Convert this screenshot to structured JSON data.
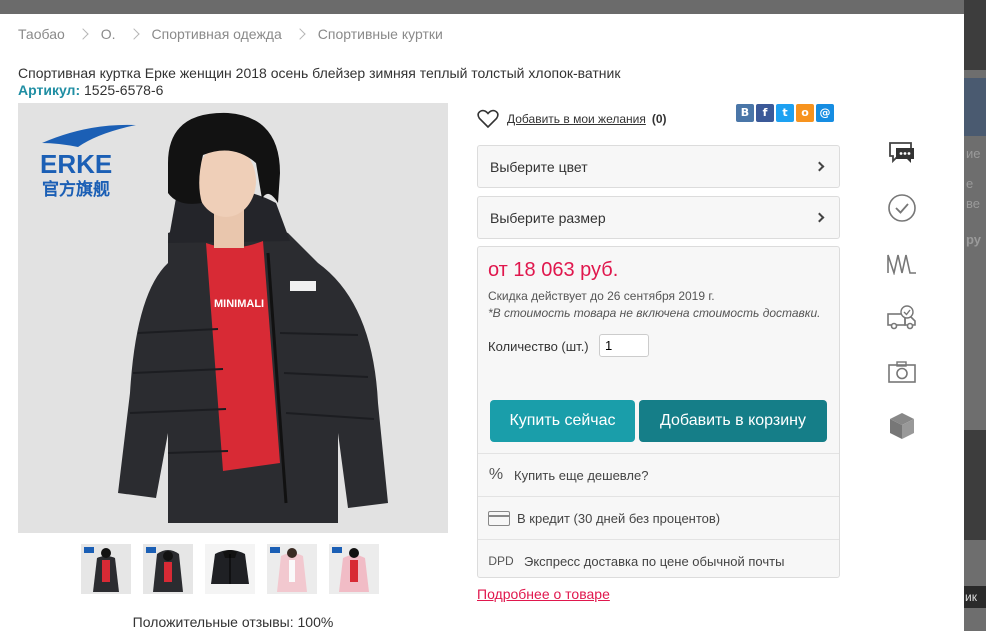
{
  "breadcrumb": [
    "Таобао",
    "О.",
    "Спортивная одежда",
    "Спортивные куртки"
  ],
  "product": {
    "title": "Спортивная куртка Ерке женщин 2018 осень блейзер зимняя теплый толстый хлопок-ватник",
    "sku_label": "Артикул:",
    "sku_value": "1525-6578-6",
    "brand_logo_text": "ERKE",
    "brand_logo_sub": "官方旗舰",
    "shirt_print": "MINIMALI",
    "reviews": "Положительные отзывы: 100%"
  },
  "wishlist": {
    "label": "Добавить в мои желания",
    "count": "(0)"
  },
  "socials": [
    {
      "name": "vk-icon",
      "glyph": "B",
      "color": "#4a76a8"
    },
    {
      "name": "facebook-icon",
      "glyph": "f",
      "color": "#3b5998"
    },
    {
      "name": "twitter-icon",
      "glyph": "t",
      "color": "#1da1f2"
    },
    {
      "name": "odnoklassniki-icon",
      "glyph": "o",
      "color": "#f7931e"
    },
    {
      "name": "mailru-icon",
      "glyph": "@",
      "color": "#168de2"
    }
  ],
  "options": {
    "color_label": "Выберите цвет",
    "size_label": "Выберите размер"
  },
  "pricing": {
    "price": "от 18 063 руб.",
    "discount": "Скидка действует до 26 сентября 2019 г.",
    "note": "*В стоимость товара не включена стоимость доставки.",
    "qty_label": "Количество (шт.)",
    "qty_value": "1"
  },
  "buttons": {
    "buy_now": "Купить сейчас",
    "add_to_cart": "Добавить в корзину"
  },
  "features": [
    {
      "icon": "percent-icon",
      "label": "Купить еще дешевле?"
    },
    {
      "icon": "credit-card-icon",
      "label": "В кредит (30 дней без процентов)"
    },
    {
      "icon": "dpd-icon",
      "icon_text": "DPD",
      "label": "Экспресс доставка по цене обычной почты"
    }
  ],
  "more_link": "Подробнее о товаре",
  "rail_icons": [
    "chat-icon",
    "check-circle-icon",
    "size-chart-icon",
    "delivery-truck-icon",
    "camera-icon",
    "package-icon"
  ],
  "background": {
    "right_texts": [
      "ие",
      "е",
      "ве",
      "ру",
      "ик"
    ]
  },
  "colors": {
    "accent_teal": "#1a9eaa",
    "accent_teal_dark": "#157e88",
    "price_red": "#e0174d",
    "sku_teal": "#1f8ea3"
  }
}
